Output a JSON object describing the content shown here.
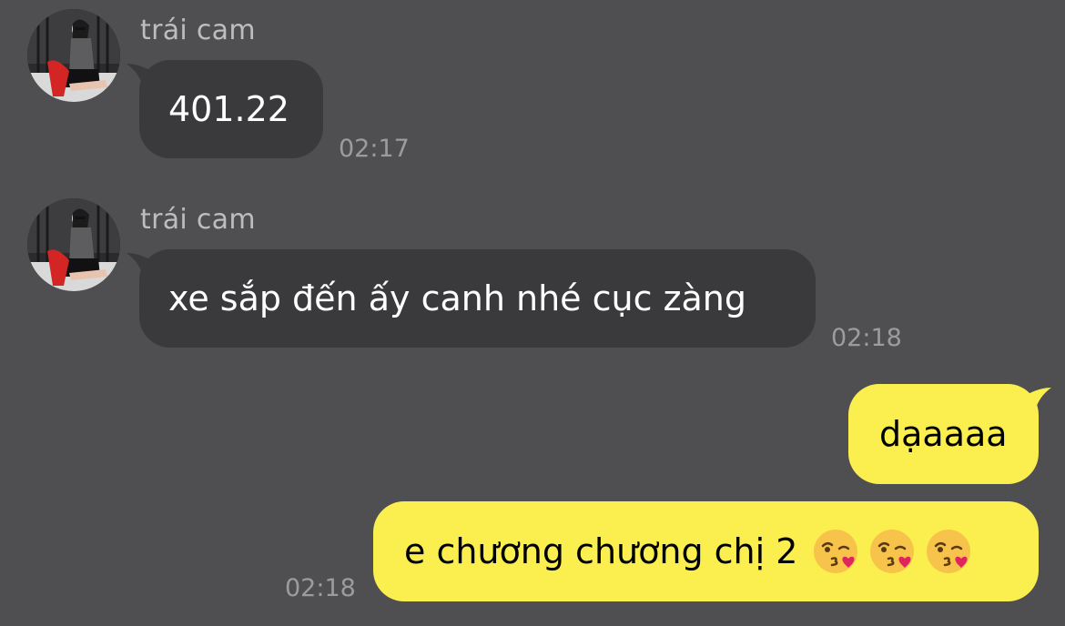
{
  "messages": [
    {
      "direction": "incoming",
      "sender": "trái cam",
      "text": "401.22",
      "time": "02:17"
    },
    {
      "direction": "incoming",
      "sender": "trái cam",
      "text": "xe sắp đến ấy canh nhé cục zàng",
      "time": "02:18"
    },
    {
      "direction": "outgoing",
      "text": "dạaaaa"
    },
    {
      "direction": "outgoing",
      "text": "e chương chương chị 2",
      "emoji": [
        "face-blowing-a-kiss-icon",
        "face-blowing-a-kiss-icon",
        "face-blowing-a-kiss-icon"
      ],
      "time": "02:18"
    }
  ],
  "colors": {
    "background": "#4f4e50",
    "incoming_bubble": "#3a393b",
    "outgoing_bubble": "#fbef4f",
    "sender_name": "#bdbdbf",
    "timestamp": "#9c9b9e"
  }
}
